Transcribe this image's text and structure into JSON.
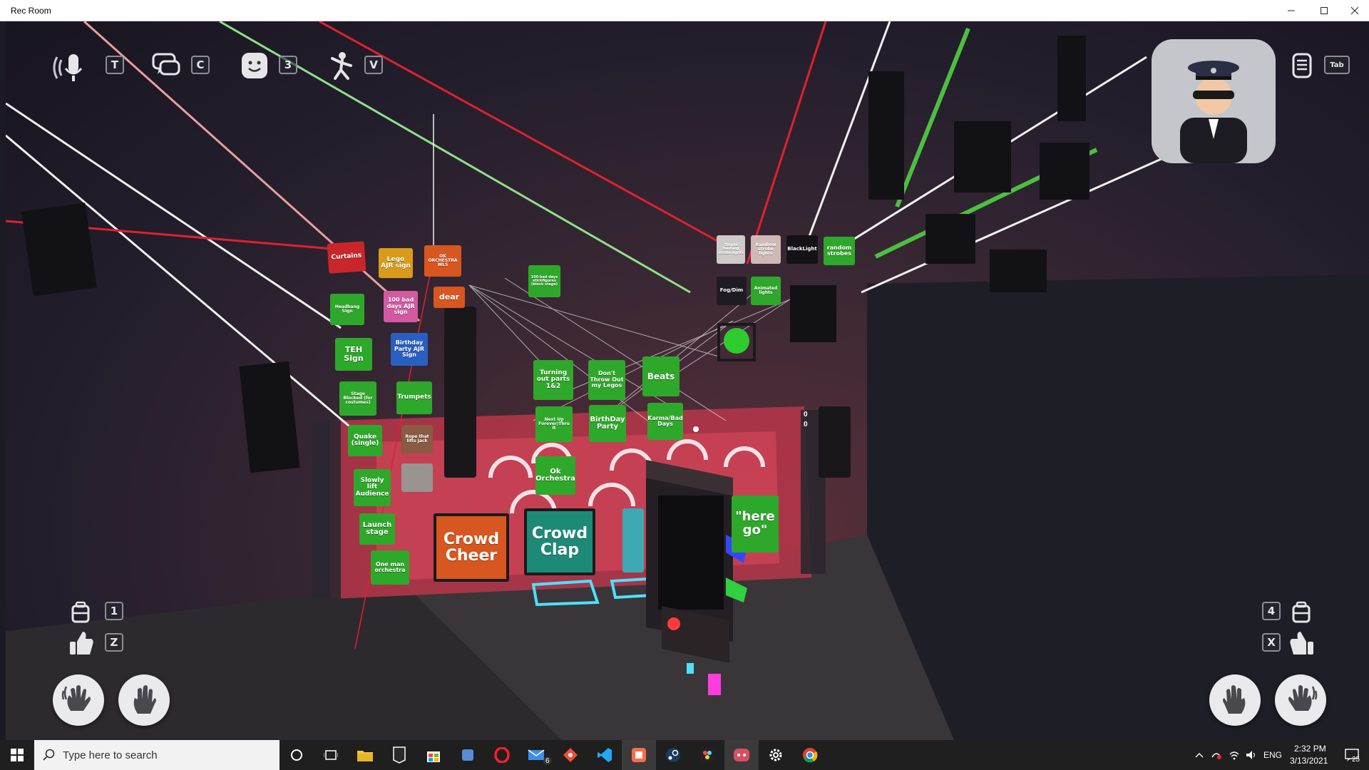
{
  "window": {
    "title": "Rec Room"
  },
  "hud": {
    "mic_key": "T",
    "chat_key": "C",
    "emote_key": "3",
    "pose_key": "V",
    "menu_key": "Tab",
    "left_backpack_key": "1",
    "left_like_key": "Z",
    "right_backpack_key": "4",
    "right_like_key": "X"
  },
  "signs": {
    "curtains": "Curtains",
    "lego_ajr": "Lego AJR sign",
    "ok_orchestra_wls": "OK ORCHESTRA WLS",
    "dear": "dear",
    "headbang": "Headbang Sign",
    "bad_days_ajr": "100 bad days AJR sign",
    "birthday_party_ajr": "Birthday Party AJR Sign",
    "teh_sign": "TEH Sign",
    "stage_blocked": "Stage Blocked (for costumes)",
    "trumpets": "Trumpets",
    "quake": "Quake (single)",
    "rope_lifts": "Rope that lifts Jack",
    "slowly_lift": "Slowly lift Audience",
    "launch_stage": "Launch stage",
    "one_man": "One man orchestra",
    "bad_days_stickfigure": "100 bad days stickfigures (block stage)",
    "turning_out": "Turning out parts 1&2",
    "dont_throw": "Don't Throw Out my Legos",
    "beats": "Beats",
    "next_up": "Next Up Forever/Thru It",
    "birthday_party": "BirthDay Party",
    "karma": "Karma/Bad Days",
    "ok_orchestra": "Ok Orchestra",
    "crowd_cheer": "Crowd Cheer",
    "crowd_clap": "Crowd Clap",
    "here_go": "\"here go\"",
    "simple_strobe": "Simple flashing strobe lights",
    "rainbow_strobe": "Rainbow strobe lights",
    "blacklight": "BlackLight",
    "random_strobes": "random strobes",
    "fog_dim": "Fog/Dim",
    "animated_lights": "Animated lights"
  },
  "counter": {
    "top": "0",
    "bottom": "0"
  },
  "taskbar": {
    "search_placeholder": "Type here to search",
    "mail_badge": "6",
    "lang": "ENG",
    "time": "2:32 PM",
    "date": "3/13/2021",
    "notif_count": "25"
  },
  "colors": {
    "sign_green": "#2ea82a",
    "sign_red": "#c9262b",
    "sign_orange": "#d8561f",
    "sign_teal": "#1d8a78",
    "taskbar_bg": "#1f1f1f"
  }
}
